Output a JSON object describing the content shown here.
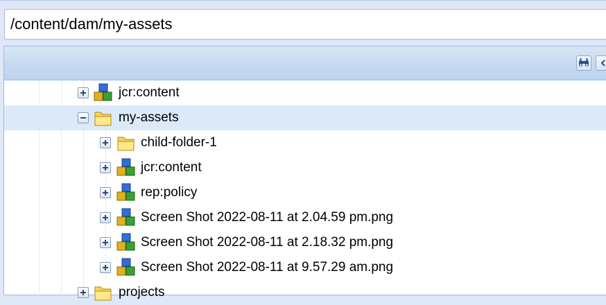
{
  "path": {
    "value": "/content/dam/my-assets"
  },
  "tree": {
    "rows": [
      {
        "label": "jcr:content",
        "icon": "node-cubes-icon",
        "state": "collapsed"
      },
      {
        "label": "my-assets",
        "icon": "folder-icon",
        "state": "expanded",
        "selected": true
      },
      {
        "label": "child-folder-1",
        "icon": "folder-icon",
        "state": "collapsed"
      },
      {
        "label": "jcr:content",
        "icon": "node-cubes-icon",
        "state": "collapsed"
      },
      {
        "label": "rep:policy",
        "icon": "node-cubes-icon",
        "state": "collapsed"
      },
      {
        "label": "Screen Shot 2022-08-11 at 2.04.59 pm.png",
        "icon": "node-cubes-icon",
        "state": "collapsed"
      },
      {
        "label": "Screen Shot 2022-08-11 at 2.18.32 pm.png",
        "icon": "node-cubes-icon",
        "state": "collapsed"
      },
      {
        "label": "Screen Shot 2022-08-11 at 9.57.29 am.png",
        "icon": "node-cubes-icon",
        "state": "collapsed"
      },
      {
        "label": "projects",
        "icon": "folder-icon",
        "state": "collapsed"
      }
    ]
  },
  "toolbar": {
    "buttons": [
      "binoculars-icon",
      "collapse-left-icon"
    ]
  },
  "colors": {
    "selection": "#dce9f8",
    "header": "#c7daf1",
    "border": "#99bbe8"
  }
}
